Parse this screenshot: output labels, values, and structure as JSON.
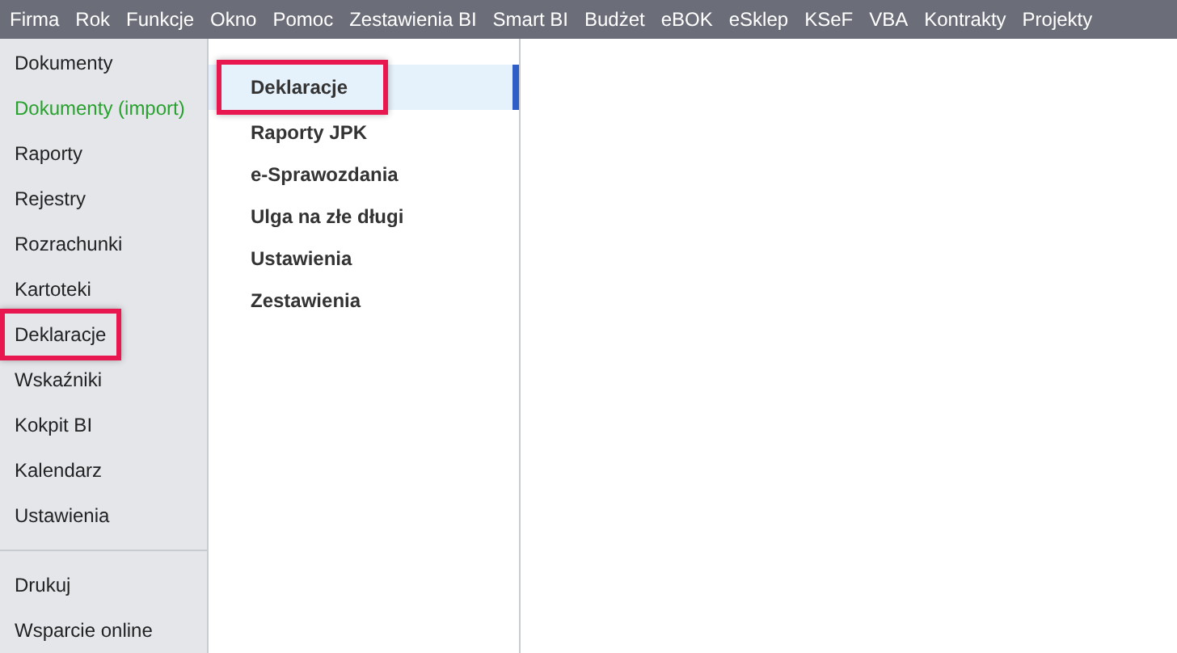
{
  "menu_bar": [
    {
      "label": "Firma"
    },
    {
      "label": "Rok"
    },
    {
      "label": "Funkcje"
    },
    {
      "label": "Okno"
    },
    {
      "label": "Pomoc"
    },
    {
      "label": "Zestawienia BI"
    },
    {
      "label": "Smart BI"
    },
    {
      "label": "Budżet"
    },
    {
      "label": "eBOK"
    },
    {
      "label": "eSklep"
    },
    {
      "label": "KSeF"
    },
    {
      "label": "VBA"
    },
    {
      "label": "Kontrakty"
    },
    {
      "label": "Projekty"
    }
  ],
  "sidebar": {
    "items": [
      {
        "label": "Dokumenty",
        "kind": "normal",
        "highlighted": false
      },
      {
        "label": "Dokumenty (import)",
        "kind": "import",
        "highlighted": false
      },
      {
        "label": "Raporty",
        "kind": "normal",
        "highlighted": false
      },
      {
        "label": "Rejestry",
        "kind": "normal",
        "highlighted": false
      },
      {
        "label": "Rozrachunki",
        "kind": "normal",
        "highlighted": false
      },
      {
        "label": "Kartoteki",
        "kind": "normal",
        "highlighted": false
      },
      {
        "label": "Deklaracje",
        "kind": "normal",
        "highlighted": true
      },
      {
        "label": "Wskaźniki",
        "kind": "normal",
        "highlighted": false
      },
      {
        "label": "Kokpit BI",
        "kind": "normal",
        "highlighted": false
      },
      {
        "label": "Kalendarz",
        "kind": "normal",
        "highlighted": false
      },
      {
        "label": "Ustawienia",
        "kind": "normal",
        "highlighted": false
      }
    ],
    "footer_items": [
      {
        "label": "Drukuj"
      },
      {
        "label": "Wsparcie online"
      }
    ]
  },
  "submenu": {
    "items": [
      {
        "label": "Deklaracje",
        "selected": true,
        "highlighted": true
      },
      {
        "label": "Raporty JPK",
        "selected": false,
        "highlighted": false
      },
      {
        "label": "e-Sprawozdania",
        "selected": false,
        "highlighted": false
      },
      {
        "label": "Ulga na złe długi",
        "selected": false,
        "highlighted": false
      },
      {
        "label": "Ustawienia",
        "selected": false,
        "highlighted": false
      },
      {
        "label": "Zestawienia",
        "selected": false,
        "highlighted": false
      }
    ]
  }
}
